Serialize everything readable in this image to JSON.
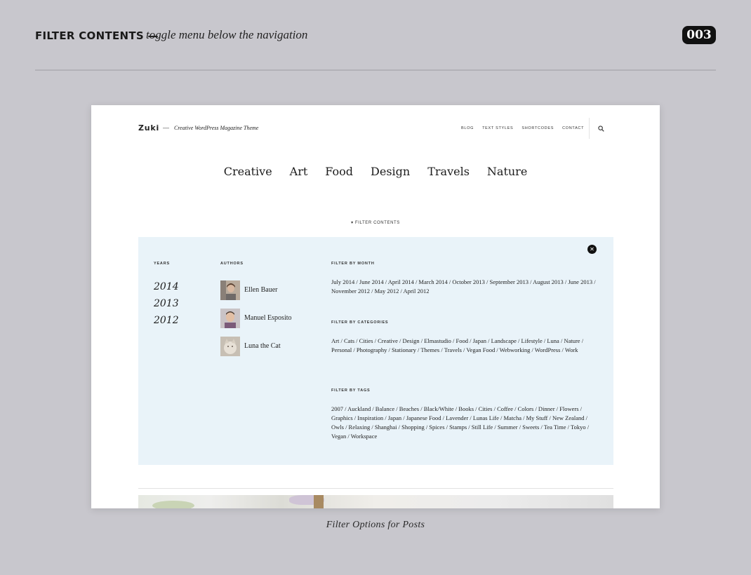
{
  "header": {
    "title": "FILTER CONTENTS —",
    "subtitle": "toggle menu below the navigation",
    "badge": "003"
  },
  "site": {
    "logo": "Zuki",
    "dash": "—",
    "tagline": "Creative WordPress Magazine Theme",
    "top_nav": [
      "BLOG",
      "TEXT STYLES",
      "SHORTCODES",
      "CONTACT"
    ],
    "main_nav": [
      "Creative",
      "Art",
      "Food",
      "Design",
      "Travels",
      "Nature"
    ],
    "filter_toggle": "▾ FILTER CONTENTS"
  },
  "panel": {
    "close": "✕",
    "years_label": "YEARS",
    "years": [
      "2014",
      "2013",
      "2012"
    ],
    "authors_label": "AUTHORS",
    "authors": [
      "Ellen Bauer",
      "Manuel Esposito",
      "Luna the Cat"
    ],
    "month_label": "FILTER BY MONTH",
    "months": "July 2014 / June 2014 / April 2014 / March 2014 / October 2013 / September 2013 / August 2013 / June 2013 / November 2012 / May 2012 / April 2012",
    "categories_label": "FILTER BY CATEGORIES",
    "categories": "Art / Cats / Cities / Creative / Design / Elmastudio / Food / Japan / Landscape / Lifestyle / Luna / Nature / Personal / Photography / Stationary / Themes / Travels / Vegan Food / Webworking / WordPress / Work",
    "tags_label": "FILTER BY TAGS",
    "tags": "2007 / Auckland / Balance / Beaches / Black/White / Books / Cities / Coffee / Colors / Dinner / Flowers / Graphics / Inspiration / Japan / Japanese Food / Lavender / Lunas Life / Matcha / My Stuff / New Zealand / Owls / Relaxing / Shanghai / Shopping / Spices / Stamps / Still Life / Summer / Sweets / Tea Time / Tokyo / Vegan / Workspace"
  },
  "caption": "Filter Options for Posts",
  "colors": {
    "background": "#c8c7cd",
    "panel": "#e9f3f9",
    "badge": "#111111"
  }
}
